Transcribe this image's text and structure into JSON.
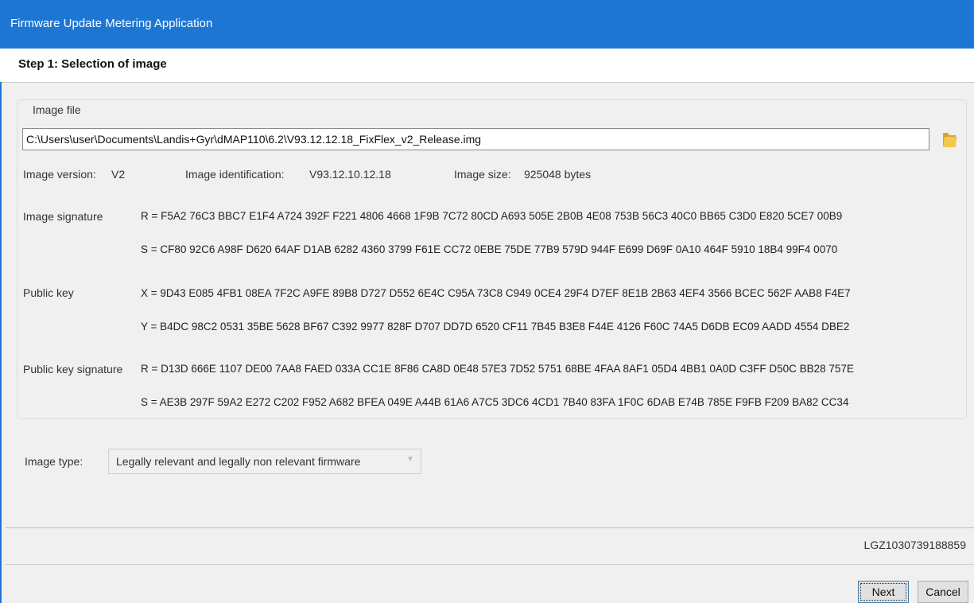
{
  "window": {
    "title": "Firmware Update Metering Application"
  },
  "step": {
    "title": "Step 1: Selection of image"
  },
  "image_file": {
    "legend": "Image file",
    "path": "C:\\Users\\user\\Documents\\Landis+Gyr\\dMAP110\\6.2\\V93.12.12.18_FixFlex_v2_Release.img",
    "folder_icon": "folder-open-icon"
  },
  "info": {
    "version_label": "Image version:",
    "version_value": "V2",
    "identification_label": "Image identification:",
    "identification_value": "V93.12.10.12.18",
    "size_label": "Image size:",
    "size_value": "925048 bytes"
  },
  "signature": {
    "label": "Image signature",
    "r": "R =  F5A2 76C3 BBC7 E1F4 A724 392F F221 4806 4668 1F9B 7C72 80CD A693 505E 2B0B 4E08 753B 56C3 40C0 BB65 C3D0 E820 5CE7 00B9",
    "s": "S =  CF80 92C6 A98F D620 64AF D1AB 6282 4360 3799 F61E CC72 0EBE 75DE 77B9 579D 944F E699 D69F 0A10 464F 5910 18B4 99F4 0070"
  },
  "public_key": {
    "label": "Public key",
    "x": "X =  9D43 E085 4FB1 08EA 7F2C A9FE 89B8 D727 D552 6E4C C95A 73C8 C949 0CE4 29F4 D7EF 8E1B 2B63 4EF4 3566 BCEC 562F AAB8 F4E7",
    "y": "Y =  B4DC 98C2 0531 35BE 5628 BF67 C392 9977 828F D707 DD7D 6520 CF11 7B45 B3E8 F44E 4126 F60C 74A5 D6DB EC09 AADD 4554 DBE2"
  },
  "public_key_signature": {
    "label": "Public key signature",
    "r": "R =  D13D 666E 1107 DE00 7AA8 FAED 033A CC1E 8F86 CA8D 0E48 57E3 7D52 5751 68BE 4FAA 8AF1 05D4 4BB1 0A0D C3FF D50C BB28 757E",
    "s": "S =  AE3B 297F 59A2 E272 C202 F952 A682 BFEA 049E A44B 61A6 A7C5 3DC6 4CD1 7B40 83FA 1F0C 6DAB E74B 785E F9FB F209 BA82 CC34"
  },
  "image_type": {
    "label": "Image type:",
    "selected": "Legally relevant and legally non relevant firmware"
  },
  "serial": "LGZ1030739188859",
  "buttons": {
    "next": "Next",
    "cancel": "Cancel"
  },
  "colors": {
    "titlebar": "#1e76d3",
    "folder": "#e8b93c"
  }
}
